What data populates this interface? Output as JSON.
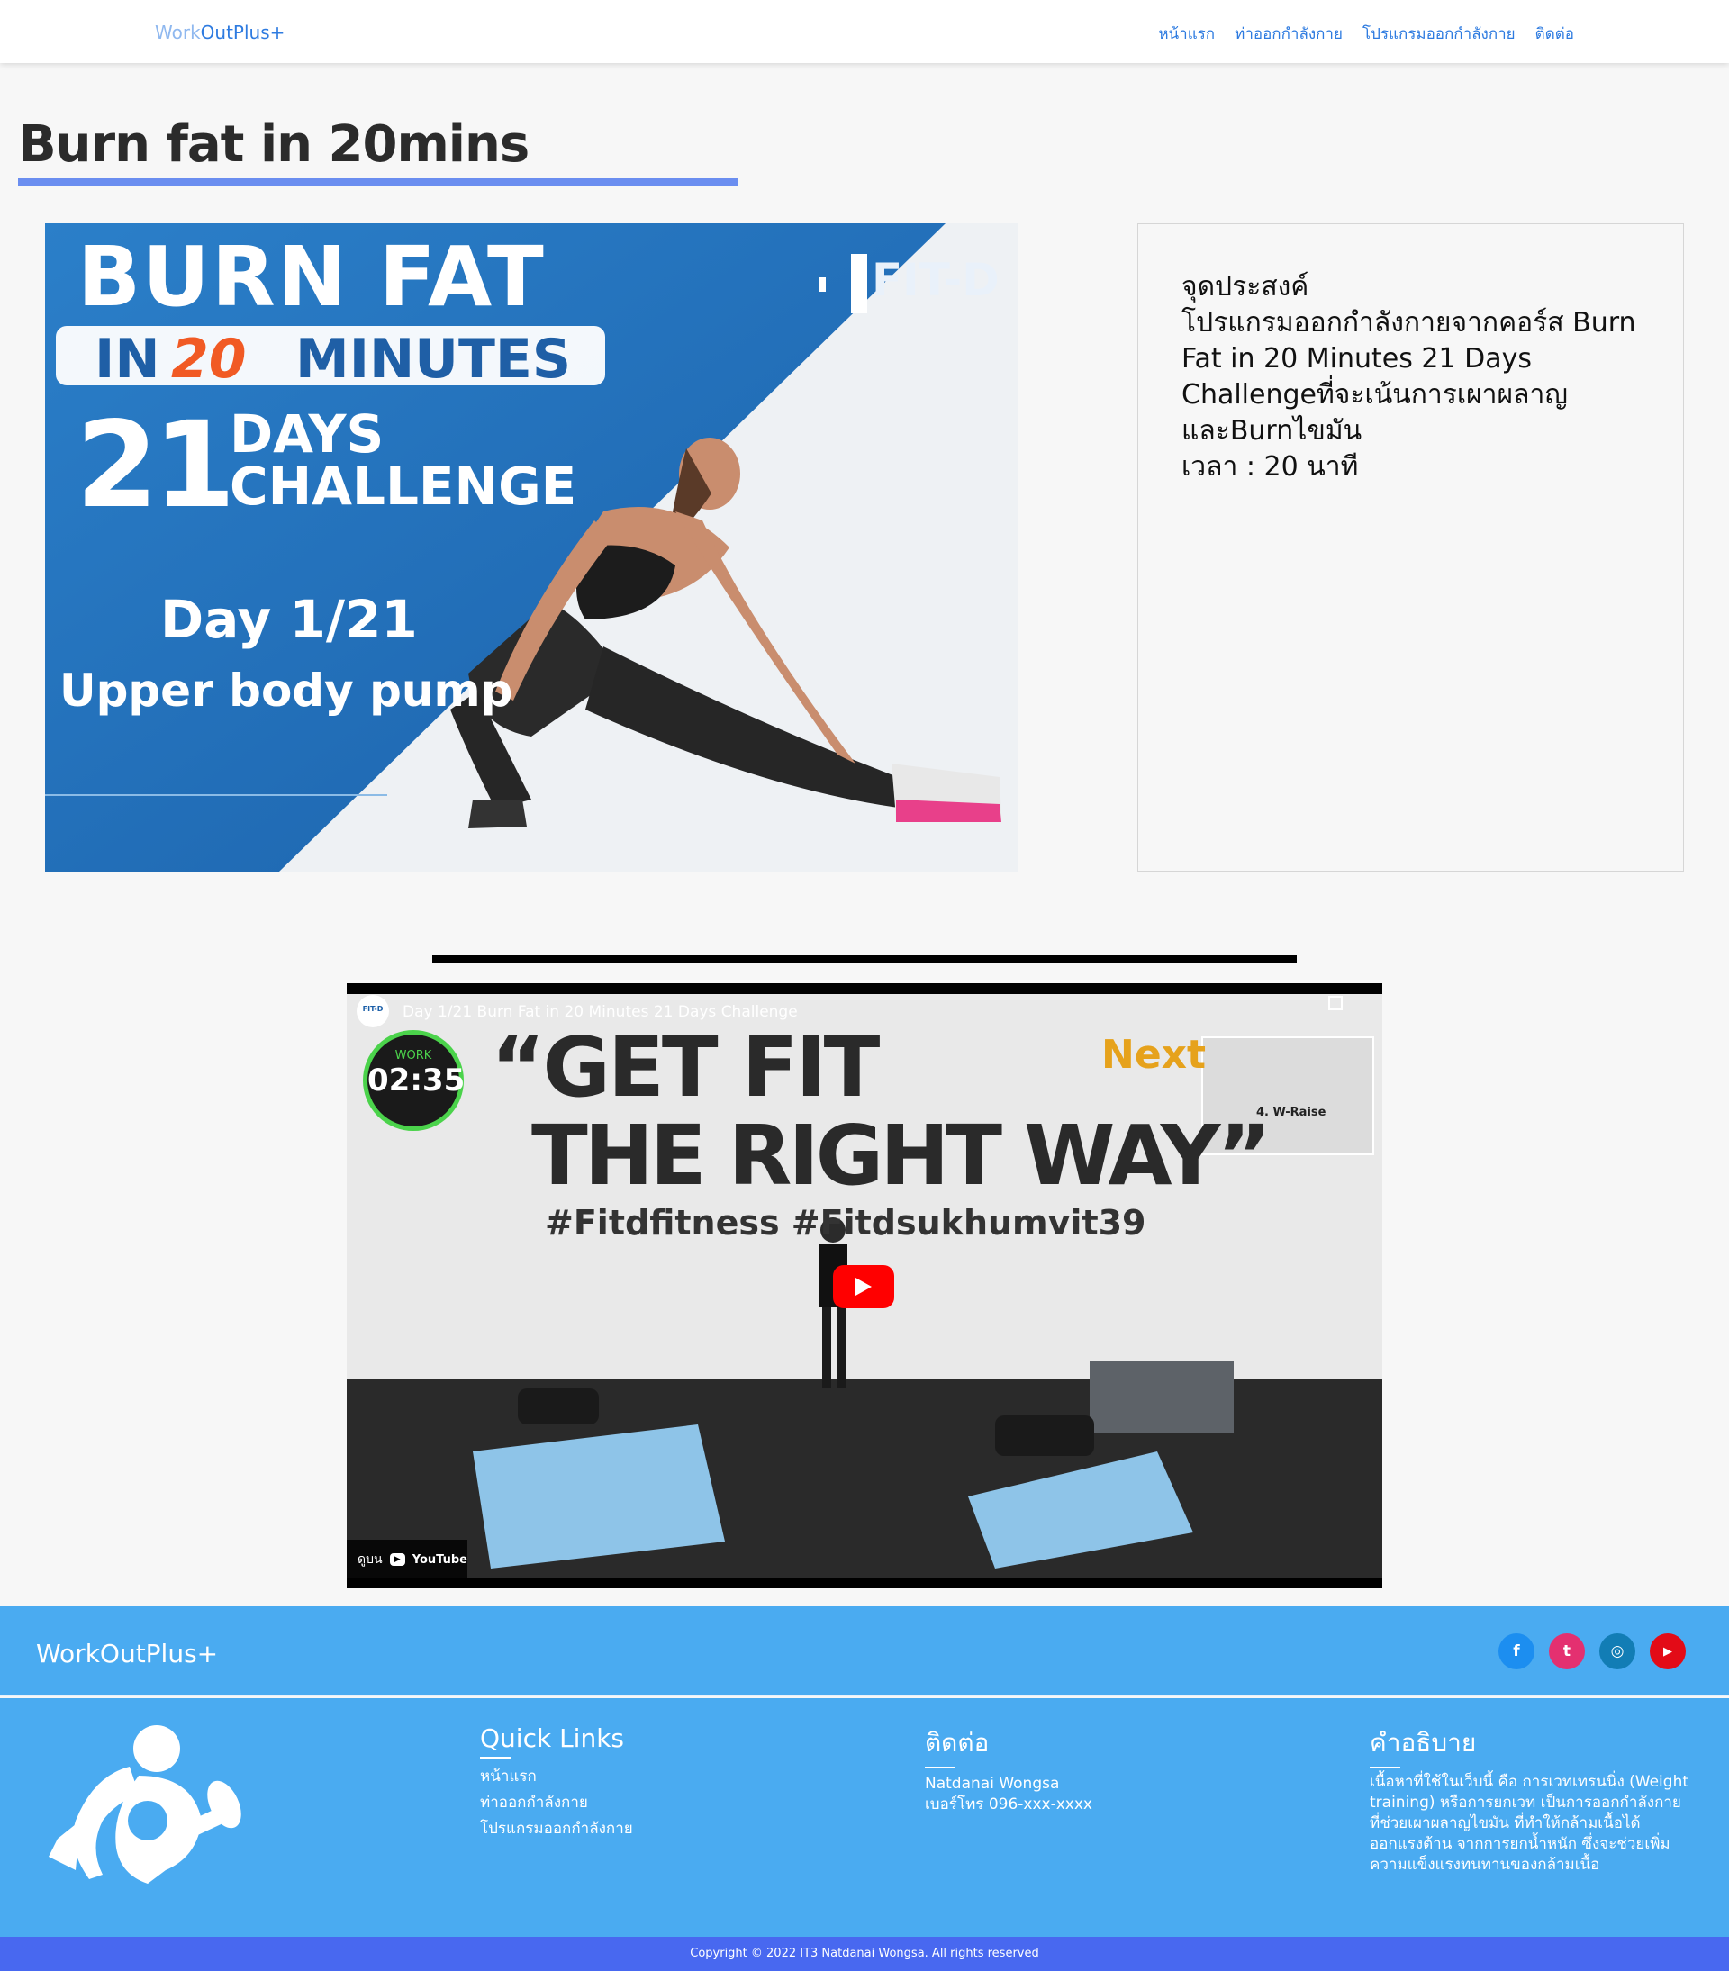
{
  "nav": {
    "brand_part1": "Work",
    "brand_part2": "OutPlus+",
    "links": [
      "หน้าแรก",
      "ท่าออกกำลังกาย",
      "โปรแกรมออกกำลังกาย",
      "ติดต่อ"
    ]
  },
  "page": {
    "title": "Burn fat in 20mins"
  },
  "hero": {
    "line1": "BURN FAT",
    "line2_in": "IN",
    "line2_num": "20",
    "line2_min": "MINUTES",
    "days_num": "21",
    "days_word": "DAYS",
    "challenge_word": "CHALLENGE",
    "brand": "FIT-D",
    "day": "Day 1/21",
    "subtitle": "Upper body pump"
  },
  "description": {
    "heading": "จุดประสงค์",
    "text": "โปรแกรมออกกำลังกายจากคอร์ส Burn Fat in 20 Minutes 21 Days Challengeที่จะเน้นการเผาผลาญ และBurnไขมัน",
    "time": "เวลา : 20 นาที"
  },
  "video": {
    "title": "Day 1/21 Burn Fat in 20 Minutes 21 Days Challenge",
    "channel_badge": "FIT-D",
    "timer_label": "WORK",
    "timer_value": "02:35",
    "poster_line1": "“GET FIT",
    "poster_line2": "THE RIGHT WAY”",
    "poster_tags": "#Fitdfitness  #Fitdsukhumvit39",
    "next_label": "Next",
    "next_caption": "4. W-Raise",
    "watch_on": "ดูบน",
    "youtube_label": "YouTube"
  },
  "footer": {
    "brand": "WorkOutPlus+",
    "socials": [
      {
        "icon": "facebook-icon",
        "glyph": "f",
        "color": "#1c8ef0"
      },
      {
        "icon": "twitter-icon",
        "glyph": "t",
        "color": "#e43070"
      },
      {
        "icon": "instagram-icon",
        "glyph": "◎",
        "color": "#127db5"
      },
      {
        "icon": "youtube-icon",
        "glyph": "▶",
        "color": "#e30b17"
      }
    ],
    "quick_links_title": "Quick Links",
    "quick_links": [
      "หน้าแรก",
      "ท่าออกกำลังกาย",
      "โปรแกรมออกกำลังกาย"
    ],
    "contact_title": "ติดต่อ",
    "contact_name": "Natdanai Wongsa",
    "contact_phone": "เบอร์โทร 096-xxx-xxxx",
    "about_title": "คำอธิบาย",
    "about_text": "เนื้อหาที่ใช้ในเว็บนี้ คือ การเวทเทรนนิ่ง (Weight training) หรือการยกเวท เป็นการออกกำลังกายที่ช่วยเผาผลาญไขมัน ที่ทำให้กล้ามเนื้อได้ออกแรงต้าน จากการยกน้ำหนัก ซึ่งจะช่วยเพิ่มความแข็งแรงทนทานของกล้ามเนื้อ",
    "copyright": "Copyright © 2022 IT3 Natdanai Wongsa. All rights reserved"
  }
}
